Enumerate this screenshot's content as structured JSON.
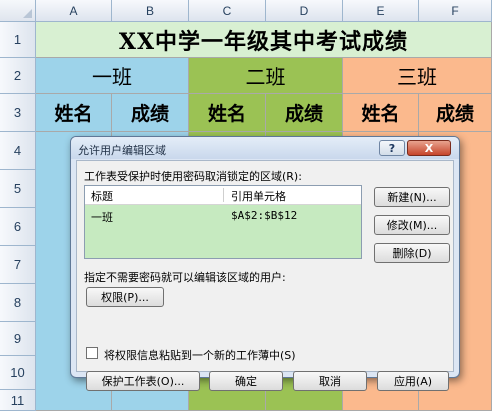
{
  "columns": [
    "A",
    "B",
    "C",
    "D",
    "E",
    "F"
  ],
  "rows": [
    "1",
    "2",
    "3",
    "4",
    "5",
    "6",
    "7",
    "8",
    "9",
    "10",
    "11"
  ],
  "sheet": {
    "title": "XX中学一年级其中考试成绩",
    "classes": [
      "一班",
      "二班",
      "三班"
    ],
    "headers": [
      "姓名",
      "成绩",
      "姓名",
      "成绩",
      "姓名",
      "成绩"
    ]
  },
  "colors": {
    "title_bg": "#d8f0d2",
    "class1": "#9dd3ea",
    "class2": "#9bc254",
    "class3": "#fbb98d",
    "dialog_bg": "#dce6f4"
  },
  "dialog": {
    "title": "允许用户编辑区域",
    "help": "?",
    "close": "X",
    "ranges_label": "工作表受保护时使用密码取消锁定的区域(R):",
    "list_header": {
      "title": "标题",
      "ref": "引用单元格"
    },
    "list_rows": [
      {
        "title": "一班",
        "ref": "$A$2:$B$12"
      }
    ],
    "new_button": "新建(N)...",
    "modify_button": "修改(M)...",
    "delete_button": "删除(D)",
    "users_label": "指定不需要密码就可以编辑该区域的用户:",
    "permissions_button": "权限(P)...",
    "paste_checkbox_label": "将权限信息粘贴到一个新的工作薄中(S)",
    "paste_checked": false,
    "protect_button": "保护工作表(O)...",
    "ok_button": "确定",
    "cancel_button": "取消",
    "apply_button": "应用(A)"
  }
}
